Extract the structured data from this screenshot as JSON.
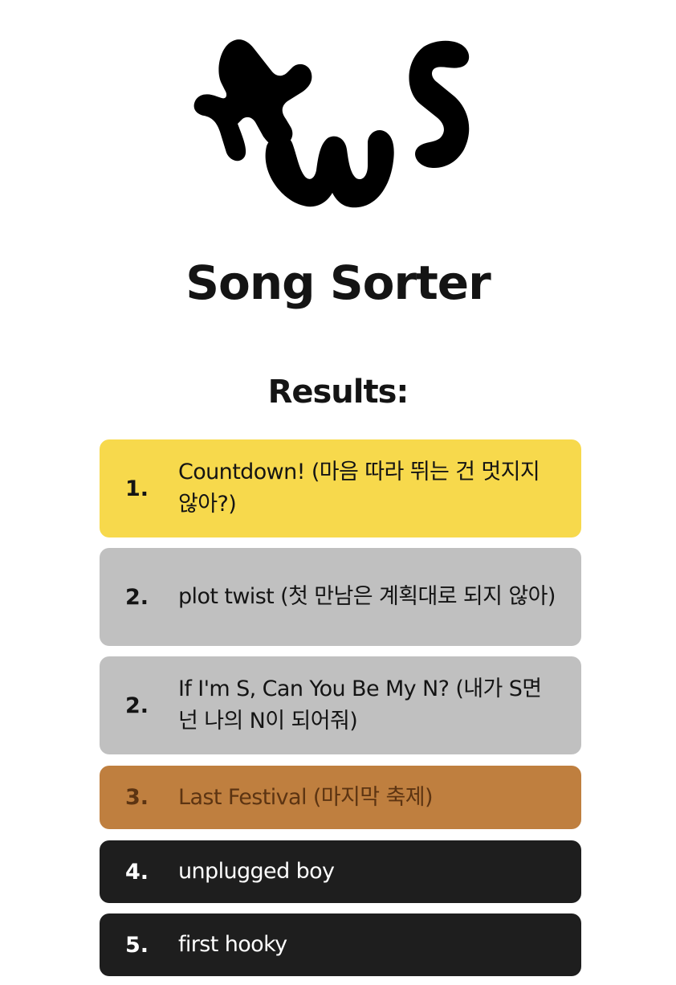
{
  "header": {
    "logo_text": "tws",
    "title": "Song Sorter"
  },
  "results": {
    "heading": "Results:",
    "items": [
      {
        "rank": "1.",
        "song": "Countdown! (마음 따라 뛰는 건 멋지지 않아?)",
        "color": "#f7d94c"
      },
      {
        "rank": "2.",
        "song": "plot twist (첫 만남은 계획대로 되지 않아)",
        "color": "#c0c0c0"
      },
      {
        "rank": "2.",
        "song": "If I'm S, Can You Be My N? (내가 S면 넌 나의 N이 되어줘)",
        "color": "#c0c0c0"
      },
      {
        "rank": "3.",
        "song": "Last Festival (마지막 축제)",
        "color": "#bf7f3f"
      },
      {
        "rank": "4.",
        "song": "unplugged boy",
        "color": "#1e1e1e"
      },
      {
        "rank": "5.",
        "song": "first hooky",
        "color": "#1e1e1e"
      }
    ]
  }
}
